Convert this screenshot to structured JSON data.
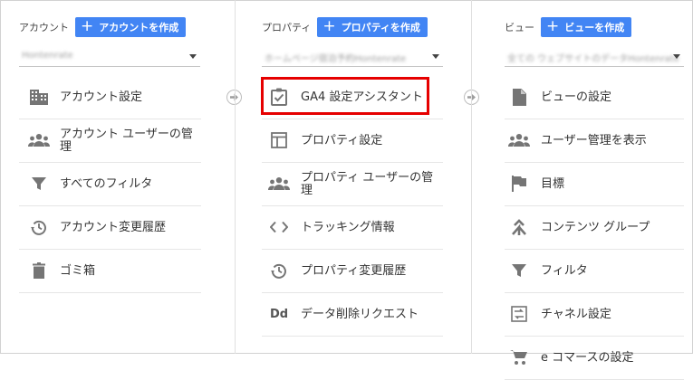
{
  "columns": [
    {
      "title": "アカウント",
      "create_label": "アカウントを作成",
      "selector_value": "Hontenrate",
      "items": [
        {
          "label": "アカウント設定",
          "icon": "building-icon"
        },
        {
          "label": "アカウント ユーザーの管理",
          "icon": "people-icon"
        },
        {
          "label": "すべてのフィルタ",
          "icon": "filter-icon"
        },
        {
          "label": "アカウント変更履歴",
          "icon": "history-icon"
        },
        {
          "label": "ゴミ箱",
          "icon": "trash-icon"
        }
      ]
    },
    {
      "title": "プロパティ",
      "create_label": "プロパティを作成",
      "selector_value": "ホームページ宿泊予約Hontenrate",
      "items": [
        {
          "label": "GA4 設定アシスタント",
          "icon": "checklist-icon"
        },
        {
          "label": "プロパティ設定",
          "icon": "property-settings-icon"
        },
        {
          "label": "プロパティ ユーザーの管理",
          "icon": "people-icon"
        },
        {
          "label": "トラッキング情報",
          "icon": "code-icon"
        },
        {
          "label": "プロパティ変更履歴",
          "icon": "history-icon"
        },
        {
          "label": "データ削除リクエスト",
          "icon": "dd-icon",
          "glyph": "Dd"
        }
      ]
    },
    {
      "title": "ビュー",
      "create_label": "ビューを作成",
      "selector_value": "全ての ウェブサイトのデータHontenrate",
      "items": [
        {
          "label": "ビューの設定",
          "icon": "document-icon"
        },
        {
          "label": "ユーザー管理を表示",
          "icon": "people-icon"
        },
        {
          "label": "目標",
          "icon": "flag-icon"
        },
        {
          "label": "コンテンツ グループ",
          "icon": "content-group-icon"
        },
        {
          "label": "フィルタ",
          "icon": "filter-icon"
        },
        {
          "label": "チャネル設定",
          "icon": "channel-icon"
        },
        {
          "label": "e コマースの設定",
          "icon": "cart-icon"
        }
      ]
    }
  ],
  "colors": {
    "accent": "#4285f4",
    "highlight": "#e60000",
    "icon": "#757575"
  }
}
